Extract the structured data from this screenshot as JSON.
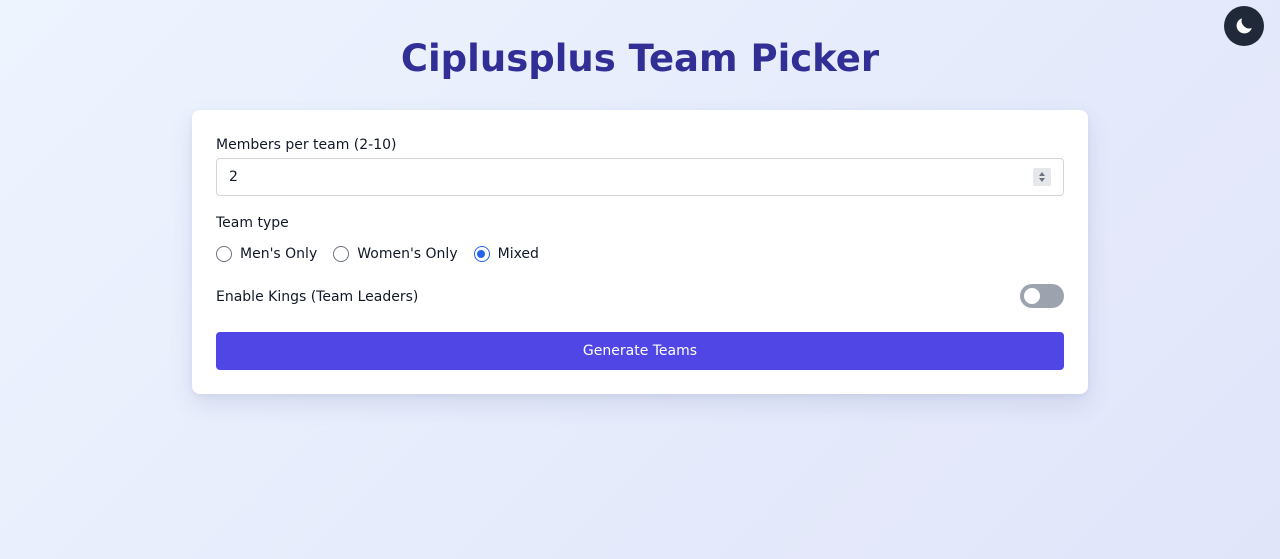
{
  "header": {
    "title": "Ciplusplus Team Picker",
    "theme_toggle_icon": "moon-icon"
  },
  "form": {
    "members": {
      "label": "Members per team (2-10)",
      "value": "2"
    },
    "team_type": {
      "label": "Team type",
      "options": [
        {
          "label": "Men's Only",
          "checked": false
        },
        {
          "label": "Women's Only",
          "checked": false
        },
        {
          "label": "Mixed",
          "checked": true
        }
      ]
    },
    "kings": {
      "label": "Enable Kings (Team Leaders)",
      "enabled": false
    },
    "generate_label": "Generate Teams"
  },
  "colors": {
    "title": "#312e96",
    "primary_button": "#4f46e5",
    "radio_accent": "#2563eb",
    "toggle_off": "#9ca3af",
    "theme_toggle_bg": "#1f2937"
  }
}
